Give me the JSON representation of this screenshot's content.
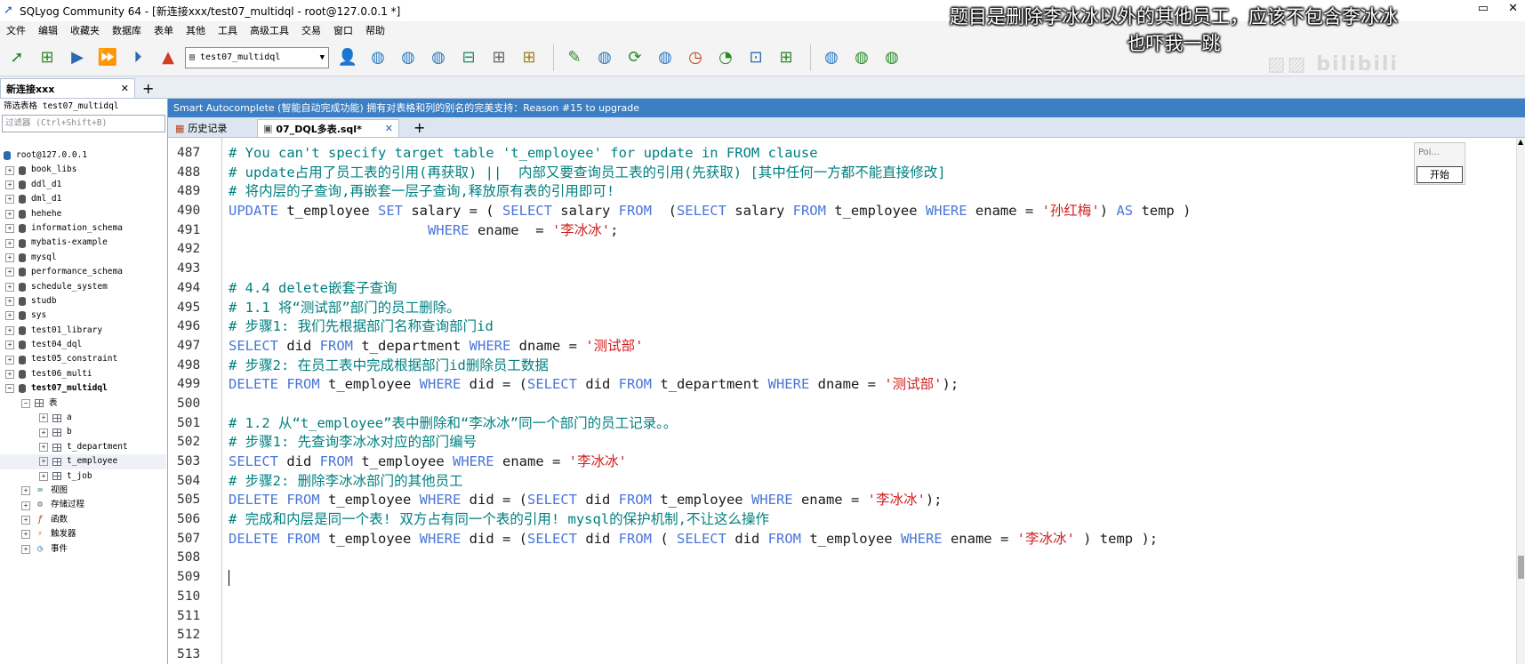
{
  "window": {
    "title": "SQLyog Community 64 - [新连接xxx/test07_multidql - root@127.0.0.1 *]",
    "controls": [
      "▭",
      "✕"
    ]
  },
  "overlay_caption": {
    "line1": "题目是删除李冰冰以外的其他员工，应该不包含李冰冰",
    "line2": "也吓我一跳"
  },
  "menubar": {
    "items": [
      "文件",
      "编辑",
      "收藏夹",
      "数据库",
      "表单",
      "其他",
      "工具",
      "高级工具",
      "交易",
      "窗口",
      "帮助"
    ]
  },
  "toolbar": {
    "db_select_value": "test07_multidql"
  },
  "connection_tabs": {
    "active_label": "新连接xxx",
    "close": "✕",
    "add": "+"
  },
  "sidebar": {
    "filter_label": "筛选表格 test07_multidql",
    "filter_placeholder": "过滤器 (Ctrl+Shift+B)",
    "root": "root@127.0.0.1",
    "databases": [
      "book_libs",
      "ddl_d1",
      "dml_d1",
      "hehehe",
      "information_schema",
      "mybatis-example",
      "mysql",
      "performance_schema",
      "schedule_system",
      "studb",
      "sys",
      "test01_library",
      "test04_dql",
      "test05_constraint",
      "test06_multi",
      "test07_multidql"
    ],
    "tables_folder": "表",
    "tables": [
      "a",
      "b",
      "t_department",
      "t_employee",
      "t_job"
    ],
    "objects": [
      "视图",
      "存储过程",
      "函数",
      "触发器",
      "事件"
    ]
  },
  "info_bar": {
    "text": "Smart Autocomplete (智能自动完成功能) 拥有对表格和列的别名的完美支持：Reason #15 to upgrade"
  },
  "doc_tabs": {
    "history": "历史记录",
    "active": "07_DQL多表.sql*",
    "close": "✕",
    "add": "+"
  },
  "editor": {
    "lines": [
      {
        "n": "487",
        "parts": [
          {
            "t": "cmt",
            "v": "# You can't specify target table 't_employee' for update in FROM clause"
          }
        ]
      },
      {
        "n": "488",
        "parts": [
          {
            "t": "cmt",
            "v": "# update占用了员工表的引用(再获取) ||  内部又要查询员工表的引用(先获取) [其中任何一方都不能直接修改]"
          }
        ]
      },
      {
        "n": "489",
        "parts": [
          {
            "t": "cmt",
            "v": "# 将内层的子查询,再嵌套一层子查询,释放原有表的引用即可!"
          }
        ]
      },
      {
        "n": "490",
        "parts": [
          {
            "t": "kw",
            "v": "UPDATE"
          },
          {
            "t": "txt",
            "v": " t_employee "
          },
          {
            "t": "kw",
            "v": "SET"
          },
          {
            "t": "txt",
            "v": " salary = ( "
          },
          {
            "t": "kw",
            "v": "SELECT"
          },
          {
            "t": "txt",
            "v": " salary "
          },
          {
            "t": "kw",
            "v": "FROM"
          },
          {
            "t": "txt",
            "v": "  ("
          },
          {
            "t": "kw",
            "v": "SELECT"
          },
          {
            "t": "txt",
            "v": " salary "
          },
          {
            "t": "kw",
            "v": "FROM"
          },
          {
            "t": "txt",
            "v": " t_employee "
          },
          {
            "t": "kw",
            "v": "WHERE"
          },
          {
            "t": "txt",
            "v": " ename = "
          },
          {
            "t": "str",
            "v": "'孙红梅'"
          },
          {
            "t": "txt",
            "v": ") "
          },
          {
            "t": "kw",
            "v": "AS"
          },
          {
            "t": "txt",
            "v": " temp )"
          }
        ]
      },
      {
        "n": "491",
        "parts": [
          {
            "t": "txt",
            "v": "                        "
          },
          {
            "t": "kw",
            "v": "WHERE"
          },
          {
            "t": "txt",
            "v": " ename  = "
          },
          {
            "t": "str",
            "v": "'李冰冰'"
          },
          {
            "t": "txt",
            "v": ";"
          }
        ]
      },
      {
        "n": "492",
        "parts": []
      },
      {
        "n": "493",
        "parts": []
      },
      {
        "n": "494",
        "parts": [
          {
            "t": "cmt",
            "v": "# 4.4 delete嵌套子查询"
          }
        ]
      },
      {
        "n": "495",
        "parts": [
          {
            "t": "cmt",
            "v": "# 1.1 将“测试部”部门的员工删除。"
          }
        ]
      },
      {
        "n": "496",
        "parts": [
          {
            "t": "cmt",
            "v": "# 步骤1: 我们先根据部门名称查询部门id"
          }
        ]
      },
      {
        "n": "497",
        "parts": [
          {
            "t": "kw",
            "v": "SELECT"
          },
          {
            "t": "txt",
            "v": " did "
          },
          {
            "t": "kw",
            "v": "FROM"
          },
          {
            "t": "txt",
            "v": " t_department "
          },
          {
            "t": "kw",
            "v": "WHERE"
          },
          {
            "t": "txt",
            "v": " dname = "
          },
          {
            "t": "str",
            "v": "'测试部'"
          }
        ]
      },
      {
        "n": "498",
        "parts": [
          {
            "t": "cmt",
            "v": "# 步骤2: 在员工表中完成根据部门id删除员工数据"
          }
        ]
      },
      {
        "n": "499",
        "parts": [
          {
            "t": "kw",
            "v": "DELETE"
          },
          {
            "t": "txt",
            "v": " "
          },
          {
            "t": "kw",
            "v": "FROM"
          },
          {
            "t": "txt",
            "v": " t_employee "
          },
          {
            "t": "kw",
            "v": "WHERE"
          },
          {
            "t": "txt",
            "v": " did = ("
          },
          {
            "t": "kw",
            "v": "SELECT"
          },
          {
            "t": "txt",
            "v": " did "
          },
          {
            "t": "kw",
            "v": "FROM"
          },
          {
            "t": "txt",
            "v": " t_department "
          },
          {
            "t": "kw",
            "v": "WHERE"
          },
          {
            "t": "txt",
            "v": " dname = "
          },
          {
            "t": "str",
            "v": "'测试部'"
          },
          {
            "t": "txt",
            "v": ");"
          }
        ]
      },
      {
        "n": "500",
        "parts": []
      },
      {
        "n": "501",
        "parts": [
          {
            "t": "cmt",
            "v": "# 1.2 从“t_employee”表中删除和“李冰冰”同一个部门的员工记录。。"
          }
        ]
      },
      {
        "n": "502",
        "parts": [
          {
            "t": "cmt",
            "v": "# 步骤1: 先查询李冰冰对应的部门编号"
          }
        ]
      },
      {
        "n": "503",
        "parts": [
          {
            "t": "kw",
            "v": "SELECT"
          },
          {
            "t": "txt",
            "v": " did "
          },
          {
            "t": "kw",
            "v": "FROM"
          },
          {
            "t": "txt",
            "v": " t_employee "
          },
          {
            "t": "kw",
            "v": "WHERE"
          },
          {
            "t": "txt",
            "v": " ename = "
          },
          {
            "t": "str",
            "v": "'李冰冰'"
          }
        ]
      },
      {
        "n": "504",
        "parts": [
          {
            "t": "cmt",
            "v": "# 步骤2: 删除李冰冰部门的其他员工"
          }
        ]
      },
      {
        "n": "505",
        "parts": [
          {
            "t": "kw",
            "v": "DELETE"
          },
          {
            "t": "txt",
            "v": " "
          },
          {
            "t": "kw",
            "v": "FROM"
          },
          {
            "t": "txt",
            "v": " t_employee "
          },
          {
            "t": "kw",
            "v": "WHERE"
          },
          {
            "t": "txt",
            "v": " did = ("
          },
          {
            "t": "kw",
            "v": "SELECT"
          },
          {
            "t": "txt",
            "v": " did "
          },
          {
            "t": "kw",
            "v": "FROM"
          },
          {
            "t": "txt",
            "v": " t_employee "
          },
          {
            "t": "kw",
            "v": "WHERE"
          },
          {
            "t": "txt",
            "v": " ename = "
          },
          {
            "t": "str",
            "v": "'李冰冰'"
          },
          {
            "t": "txt",
            "v": ");"
          }
        ]
      },
      {
        "n": "506",
        "parts": [
          {
            "t": "cmt",
            "v": "# 完成和内层是同一个表! 双方占有同一个表的引用! mysql的保护机制,不让这么操作"
          }
        ]
      },
      {
        "n": "507",
        "parts": [
          {
            "t": "kw",
            "v": "DELETE"
          },
          {
            "t": "txt",
            "v": " "
          },
          {
            "t": "kw",
            "v": "FROM"
          },
          {
            "t": "txt",
            "v": " t_employee "
          },
          {
            "t": "kw",
            "v": "WHERE"
          },
          {
            "t": "txt",
            "v": " did = ("
          },
          {
            "t": "kw",
            "v": "SELECT"
          },
          {
            "t": "txt",
            "v": " did "
          },
          {
            "t": "kw",
            "v": "FROM"
          },
          {
            "t": "txt",
            "v": " ( "
          },
          {
            "t": "kw",
            "v": "SELECT"
          },
          {
            "t": "txt",
            "v": " did "
          },
          {
            "t": "kw",
            "v": "FROM"
          },
          {
            "t": "txt",
            "v": " t_employee "
          },
          {
            "t": "kw",
            "v": "WHERE"
          },
          {
            "t": "txt",
            "v": " ename = "
          },
          {
            "t": "str",
            "v": "'李冰冰'"
          },
          {
            "t": "txt",
            "v": " ) temp );"
          }
        ]
      },
      {
        "n": "508",
        "parts": []
      },
      {
        "n": "509",
        "parts": [],
        "cursor": true
      },
      {
        "n": "510",
        "parts": []
      },
      {
        "n": "511",
        "parts": []
      },
      {
        "n": "512",
        "parts": []
      },
      {
        "n": "513",
        "parts": []
      }
    ]
  },
  "float_window": {
    "title": "Poi...",
    "button": "开始"
  }
}
